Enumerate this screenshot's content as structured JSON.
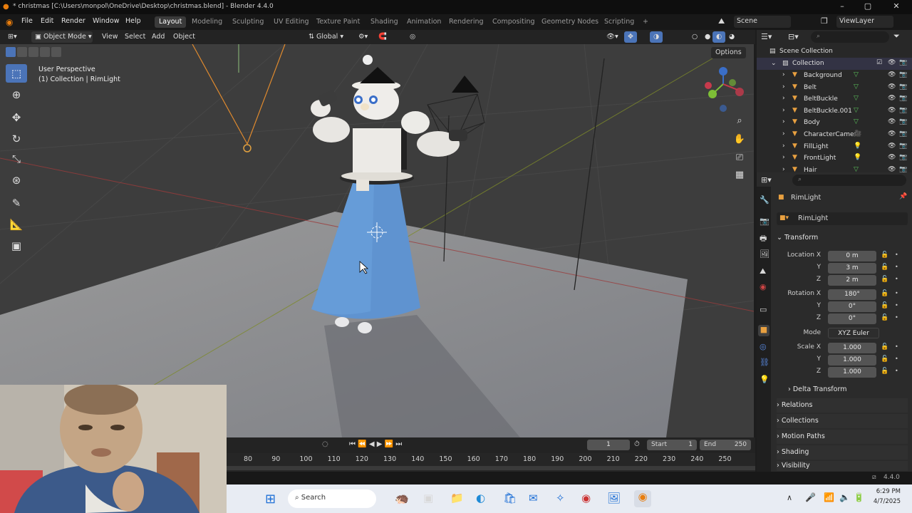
{
  "window": {
    "title": "* christmas [C:\\Users\\monpol\\OneDrive\\Desktop\\christmas.blend] - Blender 4.4.0"
  },
  "menubar": {
    "items": [
      "File",
      "Edit",
      "Render",
      "Window",
      "Help"
    ],
    "workspaces": [
      "Layout",
      "Modeling",
      "Sculpting",
      "UV Editing",
      "Texture Paint",
      "Shading",
      "Animation",
      "Rendering",
      "Compositing",
      "Geometry Nodes",
      "Scripting"
    ],
    "active_workspace": "Layout",
    "add_workspace": "+",
    "scene_label": "Scene",
    "viewlayer_label": "ViewLayer"
  },
  "viewport_header": {
    "mode": "Object Mode",
    "menus": [
      "View",
      "Select",
      "Add",
      "Object"
    ],
    "orientation": "Global",
    "options_label": "Options"
  },
  "viewport": {
    "view_name": "User Perspective",
    "collection_info": "(1) Collection | RimLight"
  },
  "icons": {
    "tools": [
      "select-box-icon",
      "cursor-icon",
      "move-icon",
      "rotate-icon",
      "scale-icon",
      "transform-icon",
      "annotate-icon",
      "measure-icon",
      "add-cube-icon"
    ],
    "nav": [
      "zoom-icon",
      "hand-pan-icon",
      "camera-view-icon",
      "grid-ortho-icon"
    ]
  },
  "outliner": {
    "search_placeholder": "",
    "root": "Scene Collection",
    "collection": "Collection",
    "items": [
      "Background",
      "Belt",
      "BeltBuckle",
      "BeltBuckle.001",
      "Body",
      "CharacterCamera",
      "FillLight",
      "FrontLight",
      "Hair"
    ]
  },
  "properties": {
    "search_placeholder": "",
    "object_name": "RimLight",
    "data_name": "RimLight",
    "transform_title": "Transform",
    "location": {
      "label": "Location X",
      "x": "0 m",
      "y": "3 m",
      "z": "2 m"
    },
    "rotation": {
      "label": "Rotation X",
      "x": "180°",
      "y": "0°",
      "z": "0°"
    },
    "mode": {
      "label": "Mode",
      "value": "XYZ Euler"
    },
    "scale": {
      "label": "Scale X",
      "x": "1.000",
      "y": "1.000",
      "z": "1.000"
    },
    "axis_y": "Y",
    "axis_z": "Z",
    "sections": [
      "Delta Transform",
      "Relations",
      "Collections",
      "Motion Paths",
      "Shading",
      "Visibility"
    ]
  },
  "timeline": {
    "current_frame": "1",
    "start_label": "Start",
    "start": "1",
    "end_label": "End",
    "end": "250",
    "ticks": [
      "80",
      "90",
      "100",
      "110",
      "120",
      "130",
      "140",
      "150",
      "160",
      "170",
      "180",
      "190",
      "200",
      "210",
      "220",
      "230",
      "240",
      "250"
    ]
  },
  "statusbar": {
    "version": "4.4.0"
  },
  "taskbar": {
    "search_label": "Search",
    "time": "6:29 PM",
    "date": "4/7/2025"
  }
}
